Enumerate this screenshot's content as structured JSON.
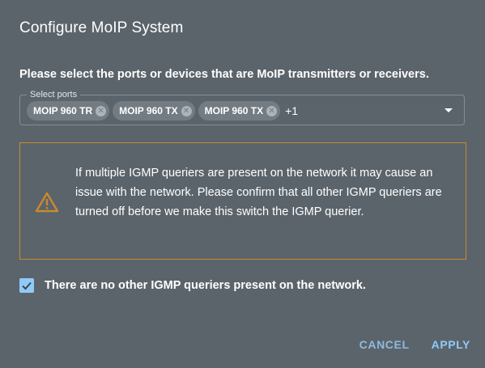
{
  "dialog": {
    "title": "Configure MoIP System",
    "instruction": "Please select the ports or devices that are MoIP transmitters or receivers.",
    "select": {
      "label": "Select ports",
      "chips": [
        "MOIP 960 TR",
        "MOIP 960 TX",
        "MOIP 960 TX"
      ],
      "more": "+1"
    },
    "warning": {
      "icon": "warning-triangle-icon",
      "text": "If multiple IGMP queriers are present on the network it may cause an issue with the network. Please confirm that all other IGMP queriers are turned off before we make this switch the IGMP querier."
    },
    "confirm": {
      "checked": true,
      "label": "There are no other IGMP queriers present on the network."
    },
    "actions": {
      "cancel": "CANCEL",
      "apply": "APPLY"
    }
  },
  "colors": {
    "background": "#5b646b",
    "accent": "#90caf9",
    "warning": "#c98a2e",
    "chip": "#737c83"
  }
}
